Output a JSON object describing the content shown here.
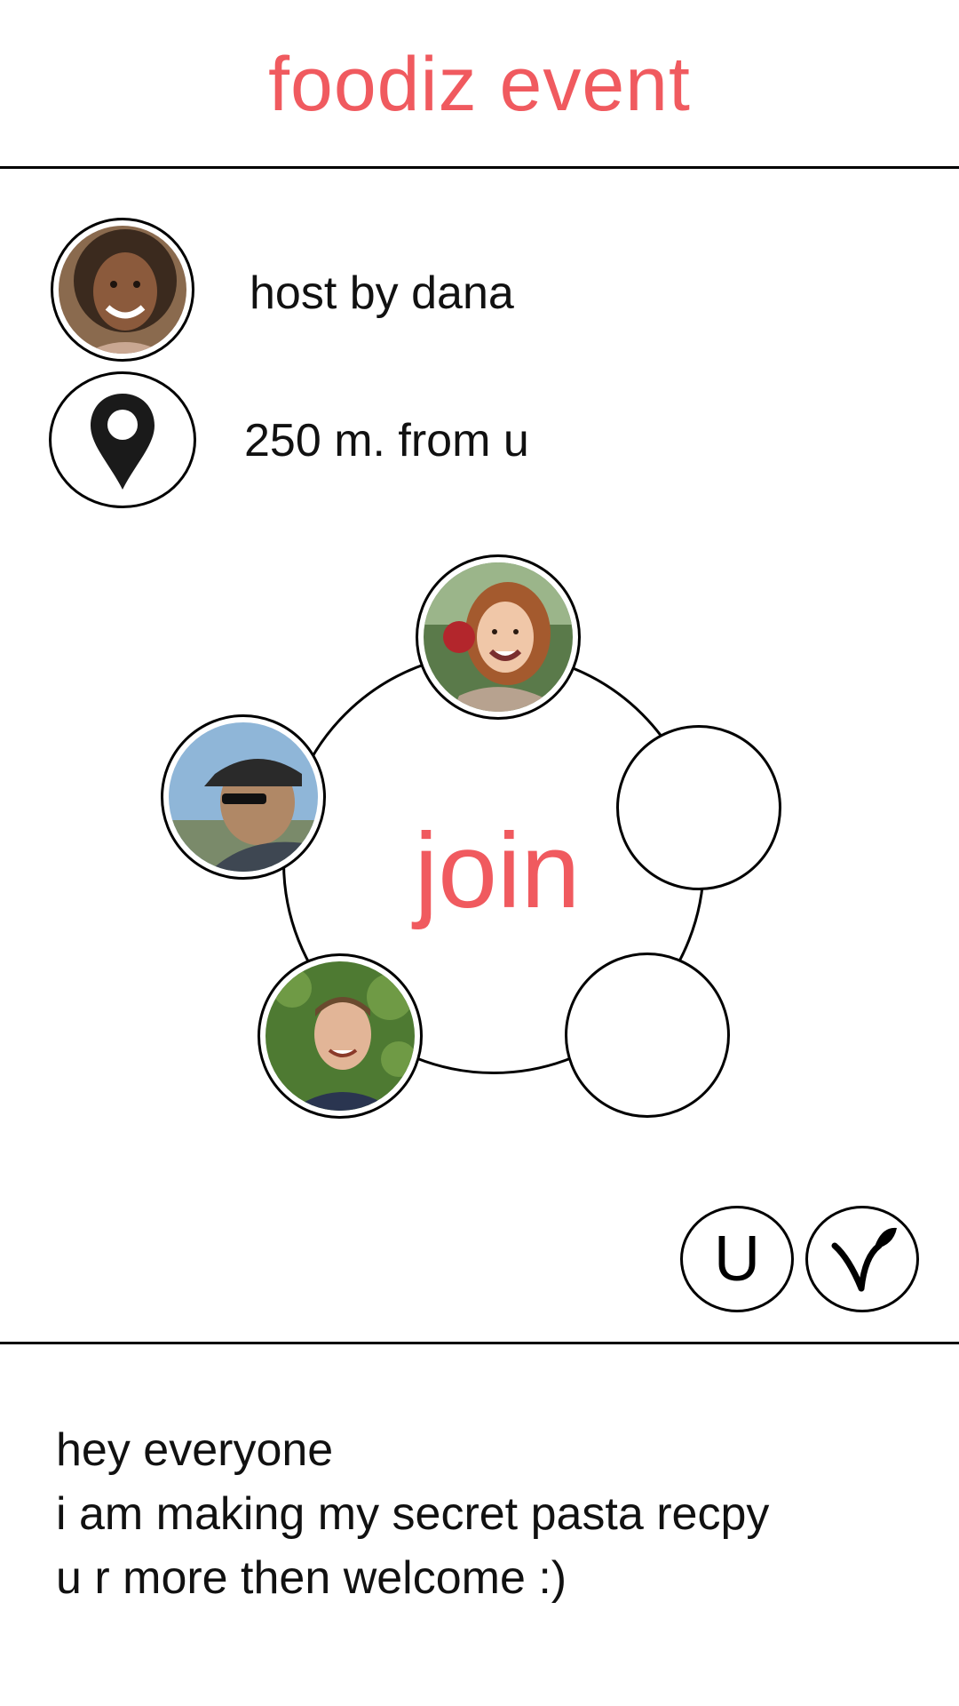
{
  "app": {
    "title": "foodiz event",
    "accent_color": "#f05a5f"
  },
  "host": {
    "label": "host by dana",
    "avatar_icon": "host-avatar-photo"
  },
  "location": {
    "distance_label": "250 m. from u",
    "icon": "map-pin-icon"
  },
  "participants": {
    "join_label": "join",
    "slots": [
      {
        "state": "filled",
        "icon": "participant-photo-woman-apple"
      },
      {
        "state": "filled",
        "icon": "participant-photo-man-cap"
      },
      {
        "state": "filled",
        "icon": "participant-photo-man-smiling"
      },
      {
        "state": "empty"
      },
      {
        "state": "empty"
      }
    ]
  },
  "badges": [
    {
      "text": "U",
      "icon": "u-badge-icon"
    },
    {
      "icon": "vegetarian-leaf-icon"
    }
  ],
  "message": {
    "lines": [
      "hey everyone",
      "i am making my secret pasta recpy",
      "u r more then welcome :)"
    ]
  }
}
